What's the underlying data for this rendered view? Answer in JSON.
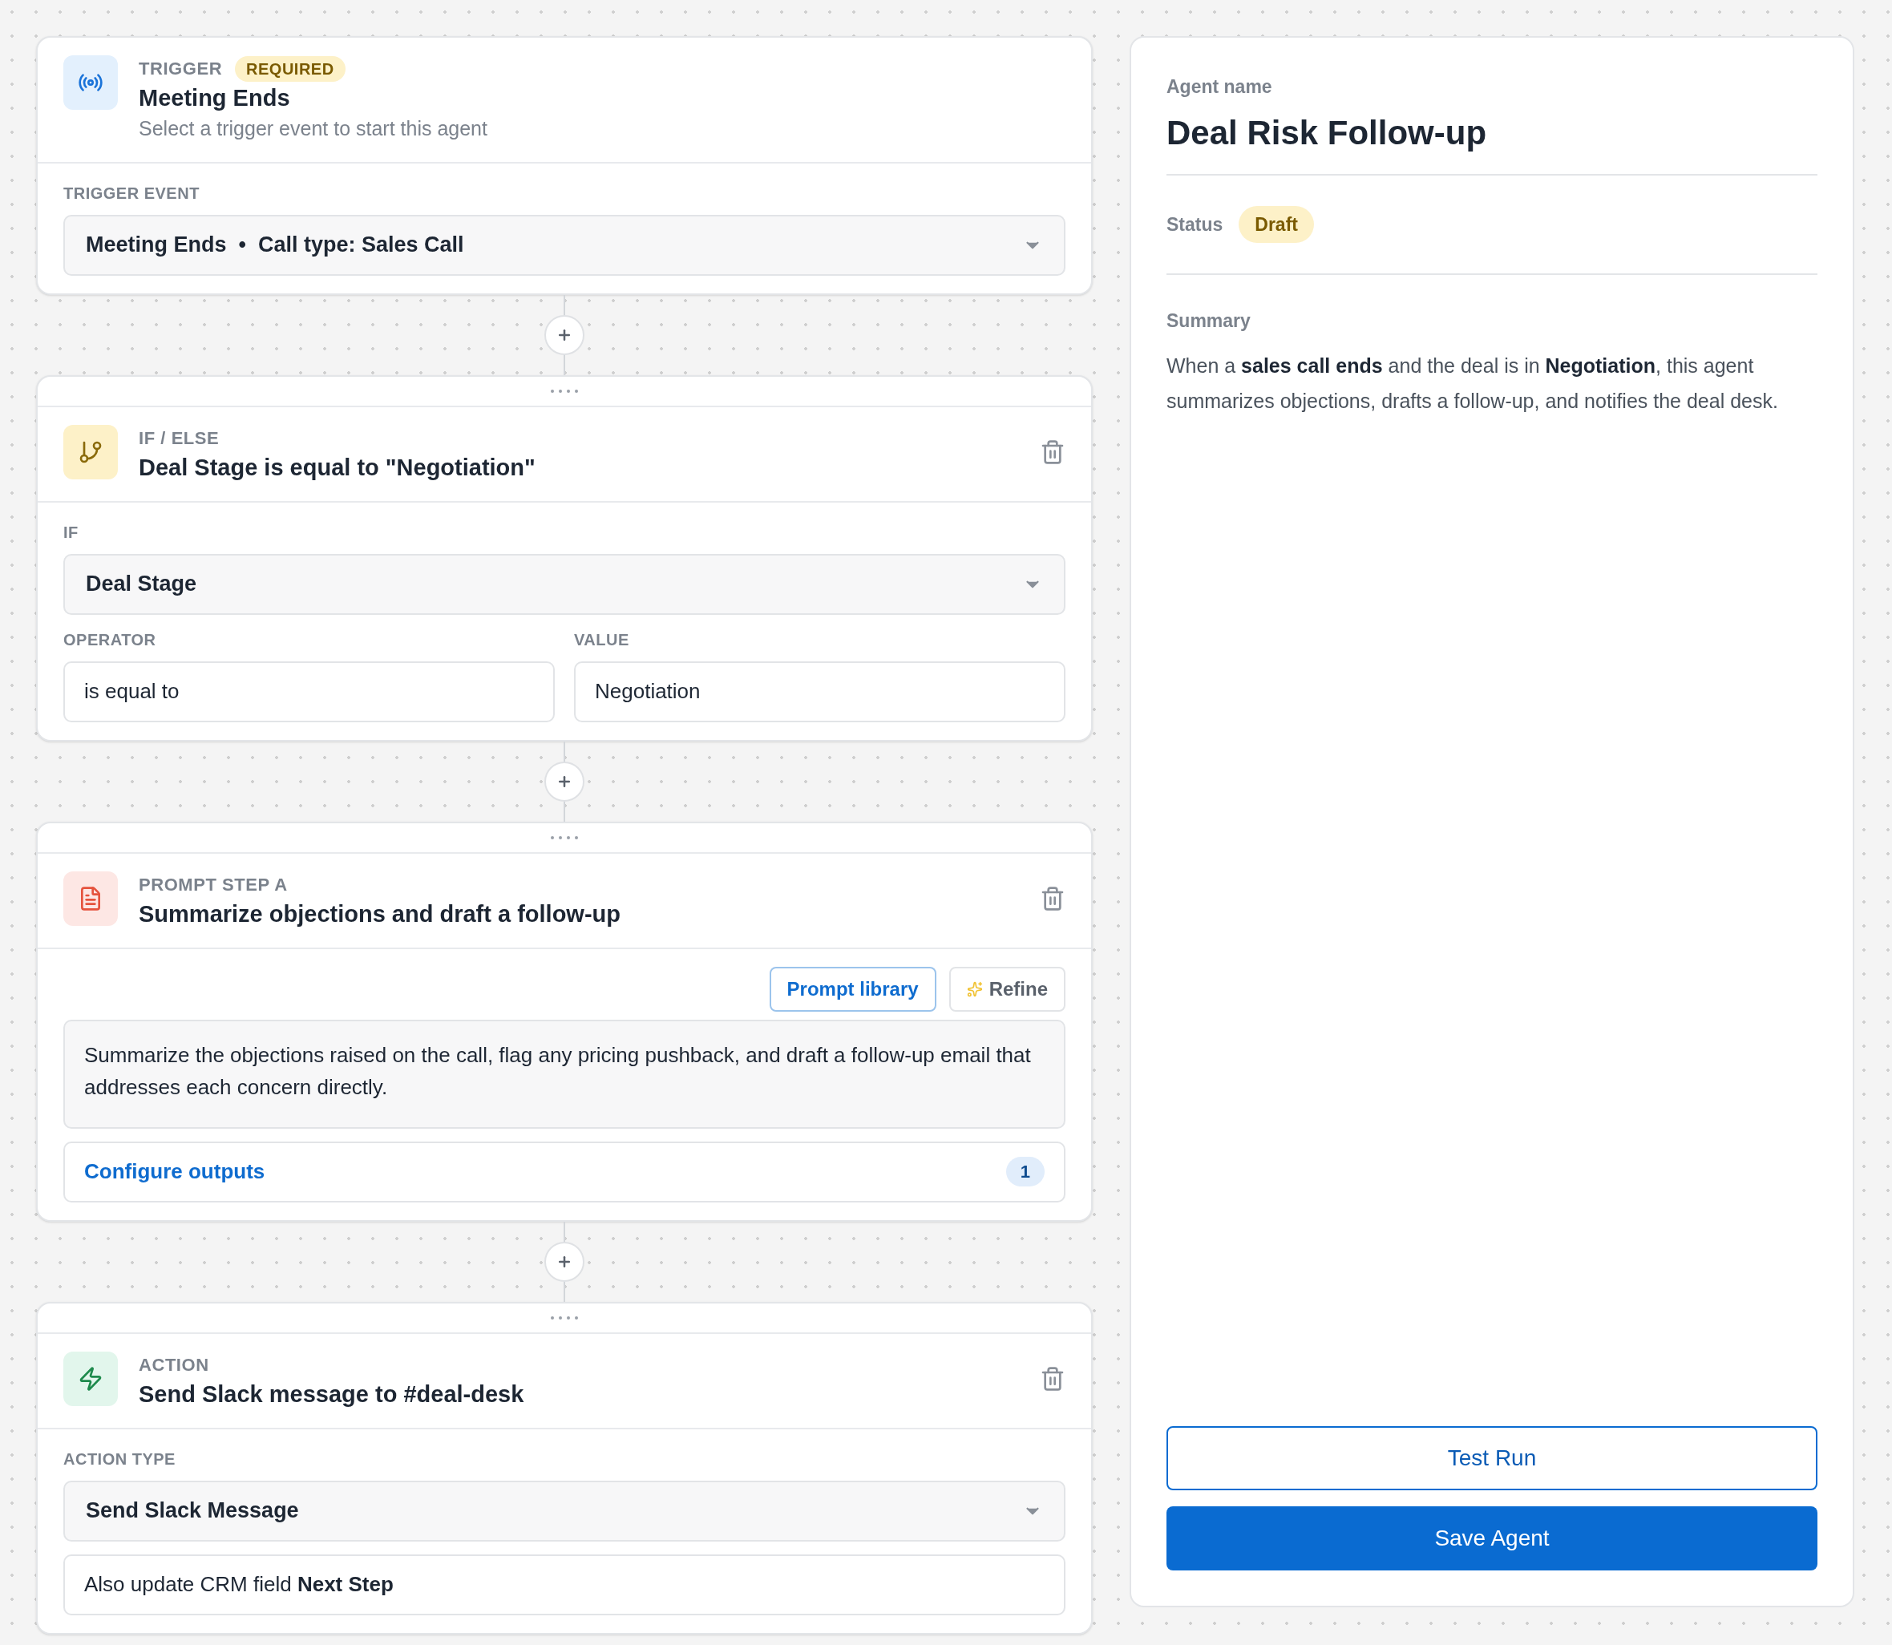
{
  "steps": [
    {
      "kind": "trigger",
      "draggable": false,
      "deletable": false,
      "label": "TRIGGER",
      "badge": "REQUIRED",
      "title": "Meeting Ends",
      "subtitle": "Select a trigger event to start this agent",
      "fields": [
        {
          "kind": "select",
          "label": "TRIGGER EVENT",
          "value": "Meeting Ends  •  Call type: Sales Call"
        }
      ]
    },
    {
      "kind": "condition",
      "draggable": true,
      "deletable": true,
      "label": "IF / ELSE",
      "title": "Deal Stage is equal to \"Negotiation\"",
      "fields": [
        {
          "kind": "select",
          "label": "IF",
          "value": "Deal Stage"
        },
        {
          "kind": "pair",
          "items": [
            {
              "label": "OPERATOR",
              "value": "is equal to"
            },
            {
              "label": "VALUE",
              "value": "Negotiation"
            }
          ]
        }
      ]
    },
    {
      "kind": "prompt",
      "draggable": true,
      "deletable": true,
      "label": "PROMPT STEP A",
      "title": "Summarize objections and draft a follow-up",
      "fields": [
        {
          "kind": "tools",
          "items": [
            {
              "kind": "library",
              "label": "Prompt library"
            },
            {
              "kind": "refine",
              "label": "Refine"
            }
          ]
        },
        {
          "kind": "textarea",
          "value": "Summarize the objections raised on the call, flag any pricing pushback, and draft a follow-up email that addresses each concern directly."
        },
        {
          "kind": "outputs",
          "label": "Configure outputs",
          "count": "1"
        }
      ]
    },
    {
      "kind": "action",
      "draggable": true,
      "deletable": true,
      "label": "ACTION",
      "title": "Send Slack message to #deal-desk",
      "fields": [
        {
          "kind": "select",
          "label": "ACTION TYPE",
          "value": "Send Slack Message"
        },
        {
          "kind": "note",
          "value": "Also update CRM field **Next Step**"
        }
      ]
    }
  ],
  "panel": {
    "name_label": "Agent name",
    "name": "Deal Risk Follow-up",
    "status_label": "Status",
    "status": "Draft",
    "summary_label": "Summary",
    "summary": "When a **sales call ends** and the deal is in **Negotiation**, this agent summarizes objections, drafts a follow-up, and notifies the deal desk.",
    "buttons": [
      {
        "kind": "secondary",
        "label": "Test Run"
      },
      {
        "kind": "primary",
        "label": "Save Agent"
      }
    ]
  }
}
